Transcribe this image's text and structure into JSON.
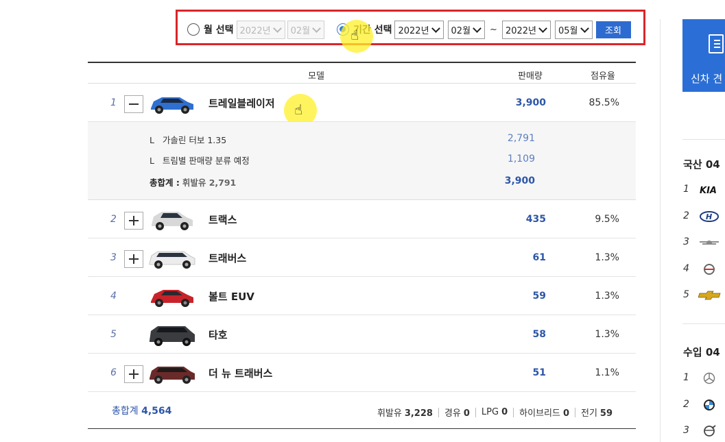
{
  "filter": {
    "month_radio_label": "월 선택",
    "month_year": "2022년",
    "month_month": "02월",
    "period_radio_label": "기간 선택",
    "from_year": "2022년",
    "from_month": "02월",
    "separator": "~",
    "to_year": "2022년",
    "to_month": "05월",
    "search_button": "조회",
    "selected": "period"
  },
  "table": {
    "headers": {
      "model": "모델",
      "sales": "판매량",
      "share": "점유율"
    },
    "rows": [
      {
        "rank": "1",
        "model": "트레일블레이저",
        "sales": "3,900",
        "share": "85.5%",
        "toggle": "minus",
        "expanded": true
      },
      {
        "rank": "2",
        "model": "트랙스",
        "sales": "435",
        "share": "9.5%",
        "toggle": "plus"
      },
      {
        "rank": "3",
        "model": "트래버스",
        "sales": "61",
        "share": "1.3%",
        "toggle": "plus"
      },
      {
        "rank": "4",
        "model": "볼트 EUV",
        "sales": "59",
        "share": "1.3%",
        "toggle": "none"
      },
      {
        "rank": "5",
        "model": "타호",
        "sales": "58",
        "share": "1.3%",
        "toggle": "none"
      },
      {
        "rank": "6",
        "model": "더 뉴 트래버스",
        "sales": "51",
        "share": "1.1%",
        "toggle": "plus"
      }
    ],
    "detail": {
      "items": [
        {
          "prefix": "L",
          "label": "가솔린 터보 1.35",
          "value": "2,791"
        },
        {
          "prefix": "L",
          "label": "트림별 판매량 분류 예정",
          "value": "1,109"
        }
      ],
      "total_label": "총합계 :",
      "total_fuel": "휘발유 2,791",
      "total_value": "3,900"
    },
    "footer": {
      "total_label": "총합계",
      "total_value": "4,564",
      "fuel": [
        {
          "label": "휘발유",
          "value": "3,228"
        },
        {
          "label": "경유",
          "value": "0"
        },
        {
          "label": "LPG",
          "value": "0"
        },
        {
          "label": "하이브리드",
          "value": "0"
        },
        {
          "label": "전기",
          "value": "59"
        }
      ]
    }
  },
  "sidebar": {
    "banner_text": "신차 견",
    "domestic_title": "국산 04",
    "domestic_ranks": [
      "1",
      "2",
      "3",
      "4",
      "5"
    ],
    "domestic_brands": [
      "kia-logo",
      "hyundai-logo",
      "genesis-logo",
      "ssangyong-logo",
      "chevrolet-logo"
    ],
    "import_title": "수입 04",
    "import_ranks": [
      "1",
      "2",
      "3"
    ],
    "import_brands": [
      "mercedes-logo",
      "bmw-logo",
      "volvo-logo"
    ]
  },
  "colors": {
    "highlight_border": "#d9252a",
    "accent": "#2e6bd0",
    "number_blue": "#2d56a8",
    "cursor_highlight": "#fff028"
  }
}
